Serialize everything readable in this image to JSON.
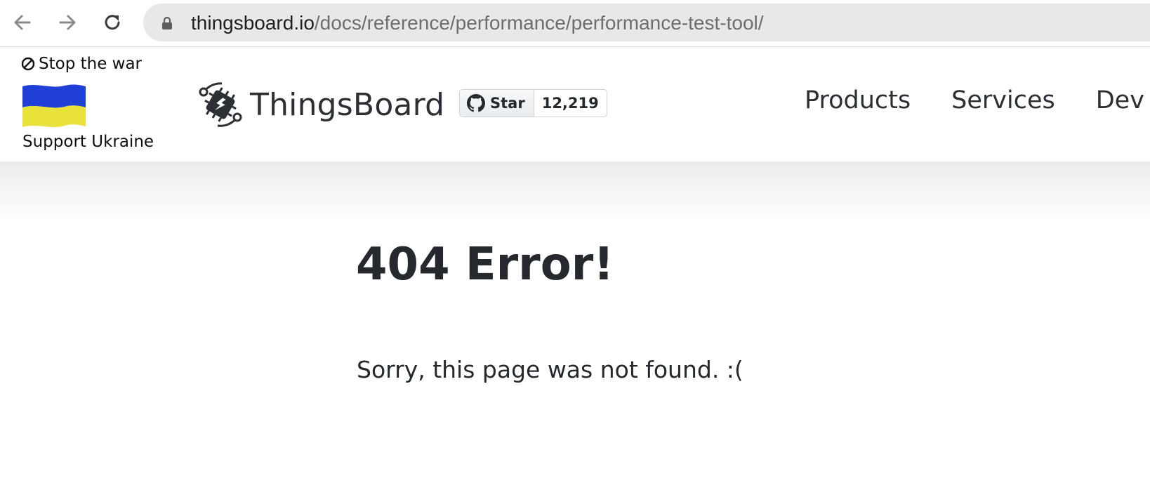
{
  "browser": {
    "url_domain": "thingsboard.io",
    "url_path": "/docs/reference/performance/performance-test-tool/"
  },
  "header": {
    "stop_war_label": "Stop the war",
    "support_label": "Support Ukraine",
    "logo_text": "ThingsBoard",
    "github": {
      "star_label": "Star",
      "star_count": "12,219"
    },
    "nav": [
      {
        "label": "Products"
      },
      {
        "label": "Services"
      },
      {
        "label": "Dev"
      }
    ]
  },
  "main": {
    "title": "404 Error!",
    "message": "Sorry, this page was not found. :("
  },
  "colors": {
    "flag_blue": "#1f3fd6",
    "flag_yellow": "#e8e23a",
    "text": "#25292d"
  },
  "icons": [
    "back-arrow-icon",
    "forward-arrow-icon",
    "reload-icon",
    "lock-icon",
    "ban-icon",
    "ukraine-flag",
    "thingsboard-logo-icon",
    "github-icon"
  ]
}
